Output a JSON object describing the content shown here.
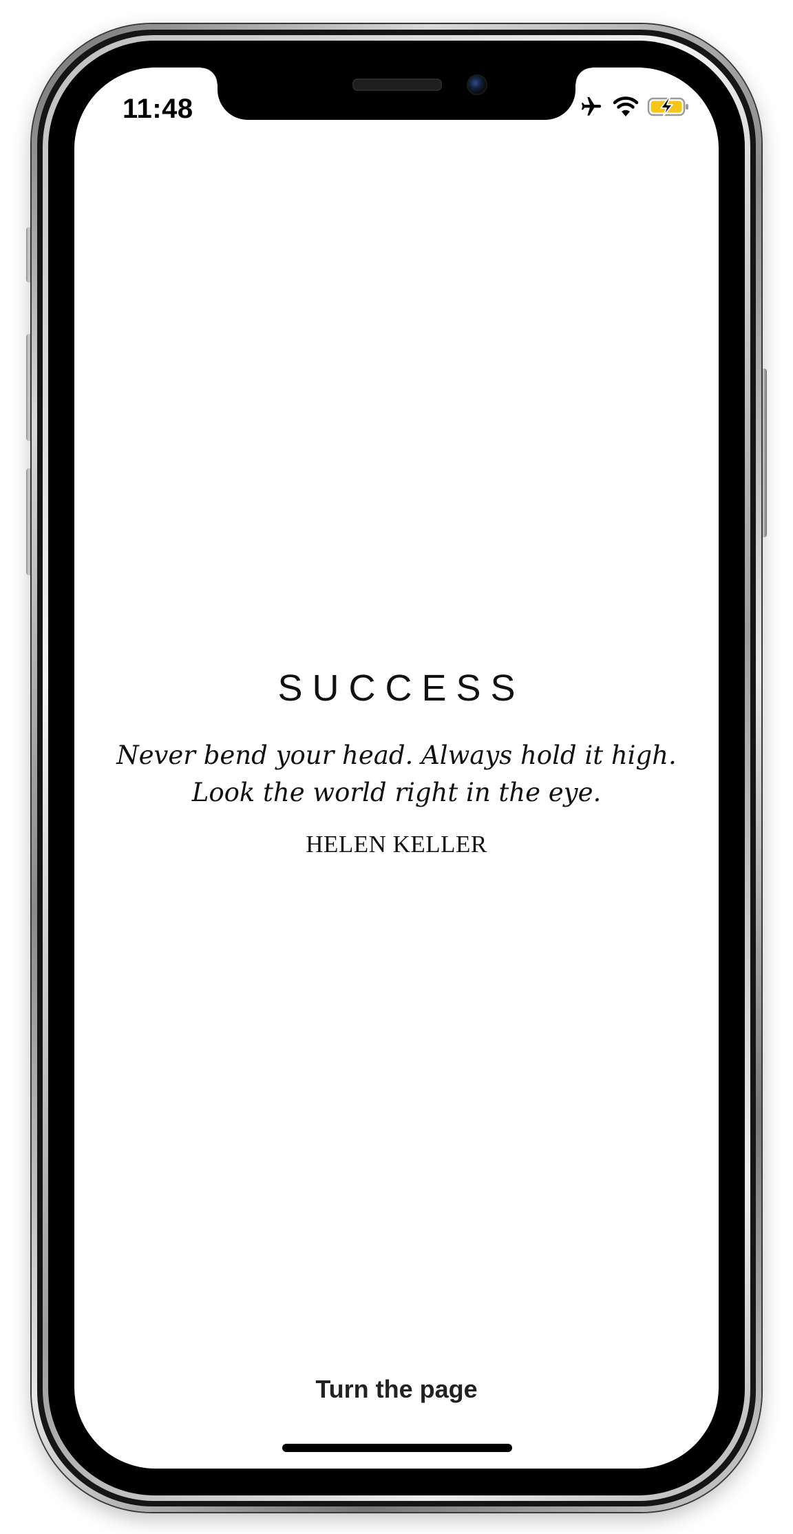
{
  "status_bar": {
    "time": "11:48",
    "icons": [
      "airplane-icon",
      "wifi-icon",
      "battery-charging-icon"
    ],
    "battery_color": "#f5c518"
  },
  "content": {
    "category": "SUCCESS",
    "quote_line_1": "Never bend your head. Always hold it high.",
    "quote_line_2": "Look the world right in the eye.",
    "author": "HELEN KELLER"
  },
  "footer": {
    "turn_page_label": "Turn the page"
  }
}
